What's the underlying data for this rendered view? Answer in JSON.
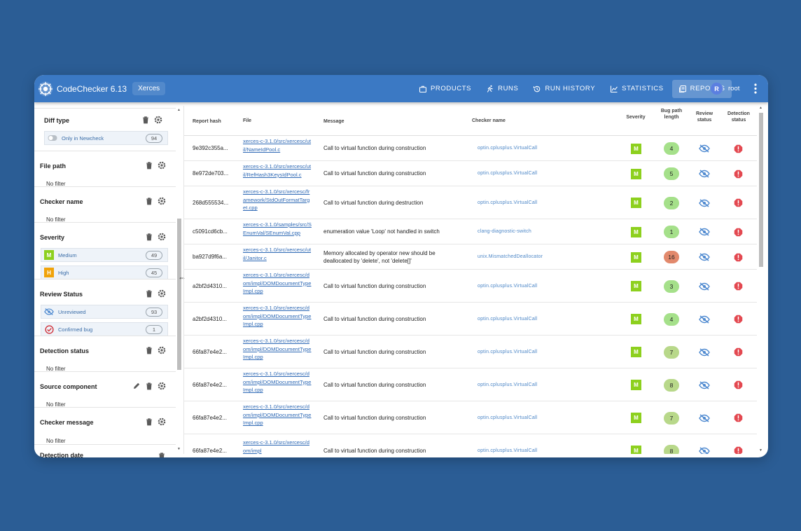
{
  "header": {
    "app_title": "CodeChecker 6.13",
    "product": "Xerces",
    "nav": [
      {
        "label": "PRODUCTS",
        "icon": "briefcase-icon"
      },
      {
        "label": "RUNS",
        "icon": "runner-icon"
      },
      {
        "label": "RUN HISTORY",
        "icon": "history-icon"
      },
      {
        "label": "STATISTICS",
        "icon": "chart-line-icon"
      },
      {
        "label": "REPORTS",
        "icon": "reports-icon"
      }
    ],
    "active_nav": "REPORTS",
    "user_initial": "R",
    "user_name": "root"
  },
  "sidebar": {
    "filters": [
      {
        "title": "Diff type",
        "option": {
          "label": "Only in Newcheck",
          "count": "94"
        }
      },
      {
        "title": "File path",
        "value": "No filter"
      },
      {
        "title": "Checker name",
        "value": "No filter"
      },
      {
        "title": "Severity",
        "options": [
          {
            "badge": "M",
            "label": "Medium",
            "count": "49",
            "color": "#8dd01e"
          },
          {
            "badge": "H",
            "label": "High",
            "count": "45",
            "color": "#f0a30a"
          }
        ]
      },
      {
        "title": "Review Status",
        "options": [
          {
            "label": "Unreviewed",
            "count": "93",
            "icon": "eye-slash-icon"
          },
          {
            "label": "Confirmed bug",
            "count": "1",
            "icon": "check-circle-icon"
          }
        ]
      },
      {
        "title": "Detection status",
        "value": "No filter"
      },
      {
        "title": "Source component",
        "value": "No filter"
      },
      {
        "title": "Checker message",
        "value": "No filter"
      },
      {
        "title": "Detection date"
      }
    ]
  },
  "table": {
    "columns": {
      "hash": "Report hash",
      "file": "File",
      "message": "Message",
      "checker": "Checker name",
      "severity": "Severity",
      "bug_path": "Bug path length",
      "review": "Review status",
      "detection": "Detection status"
    },
    "rows": [
      {
        "hash": "9e392c355a...",
        "file": "xerces-c-3.1.0/src/xercesc/util/NameIdPool.c",
        "message": "Call to virtual function during construction",
        "checker": "optin.cplusplus.VirtualCall",
        "severity": "M",
        "length": "4"
      },
      {
        "hash": "8e972de703...",
        "file": "xerces-c-3.1.0/src/xercesc/util/RefHash3KeysIdPool.c",
        "message": "Call to virtual function during construction",
        "checker": "optin.cplusplus.VirtualCall",
        "severity": "M",
        "length": "5"
      },
      {
        "hash": "268d555534...",
        "file": "xerces-c-3.1.0/src/xercesc/framework/StdOutFormatTarget.cpp",
        "message": "Call to virtual function during destruction",
        "checker": "optin.cplusplus.VirtualCall",
        "severity": "M",
        "length": "2"
      },
      {
        "hash": "c5091cd6cb...",
        "file": "xerces-c-3.1.0/samples/src/SEnumVal/SEnumVal.cpp",
        "message": "enumeration value 'Loop' not handled in switch",
        "checker": "clang-diagnostic-switch",
        "severity": "M",
        "length": "1"
      },
      {
        "hash": "ba927d9f6a...",
        "file": "xerces-c-3.1.0/src/xercesc/util/Janitor.c",
        "message": "Memory allocated by operator new should be deallocated by 'delete', not 'delete[]'",
        "checker": "unix.MismatchedDeallocator",
        "severity": "M",
        "length": "16"
      },
      {
        "hash": "a2bf2d4310...",
        "file": "xerces-c-3.1.0/src/xercesc/dom/impl/DOMDocumentTypeImpl.cpp",
        "message": "Call to virtual function during construction",
        "checker": "optin.cplusplus.VirtualCall",
        "severity": "M",
        "length": "3"
      },
      {
        "hash": "a2bf2d4310...",
        "file": "xerces-c-3.1.0/src/xercesc/dom/impl/DOMDocumentTypeImpl.cpp",
        "message": "Call to virtual function during construction",
        "checker": "optin.cplusplus.VirtualCall",
        "severity": "M",
        "length": "4"
      },
      {
        "hash": "66fa87e4e2...",
        "file": "xerces-c-3.1.0/src/xercesc/dom/impl/DOMDocumentTypeImpl.cpp",
        "message": "Call to virtual function during construction",
        "checker": "optin.cplusplus.VirtualCall",
        "severity": "M",
        "length": "7"
      },
      {
        "hash": "66fa87e4e2...",
        "file": "xerces-c-3.1.0/src/xercesc/dom/impl/DOMDocumentTypeImpl.cpp",
        "message": "Call to virtual function during construction",
        "checker": "optin.cplusplus.VirtualCall",
        "severity": "M",
        "length": "8"
      },
      {
        "hash": "66fa87e4e2...",
        "file": "xerces-c-3.1.0/src/xercesc/dom/impl/DOMDocumentTypeImpl.cpp",
        "message": "Call to virtual function during construction",
        "checker": "optin.cplusplus.VirtualCall",
        "severity": "M",
        "length": "7"
      },
      {
        "hash": "66fa87e4e2...",
        "file": "xerces-c-3.1.0/src/xercesc/dom/impl",
        "message": "Call to virtual function during construction",
        "checker": "optin.cplusplus.VirtualCall",
        "severity": "M",
        "length": "8"
      }
    ]
  },
  "colors": {
    "background": "#2b5d95",
    "header": "#3b79c4",
    "severity_medium": "#8dd01e",
    "severity_high": "#f0a30a",
    "detection_icon": "#e34850",
    "review_icon": "#4f8ad0"
  }
}
